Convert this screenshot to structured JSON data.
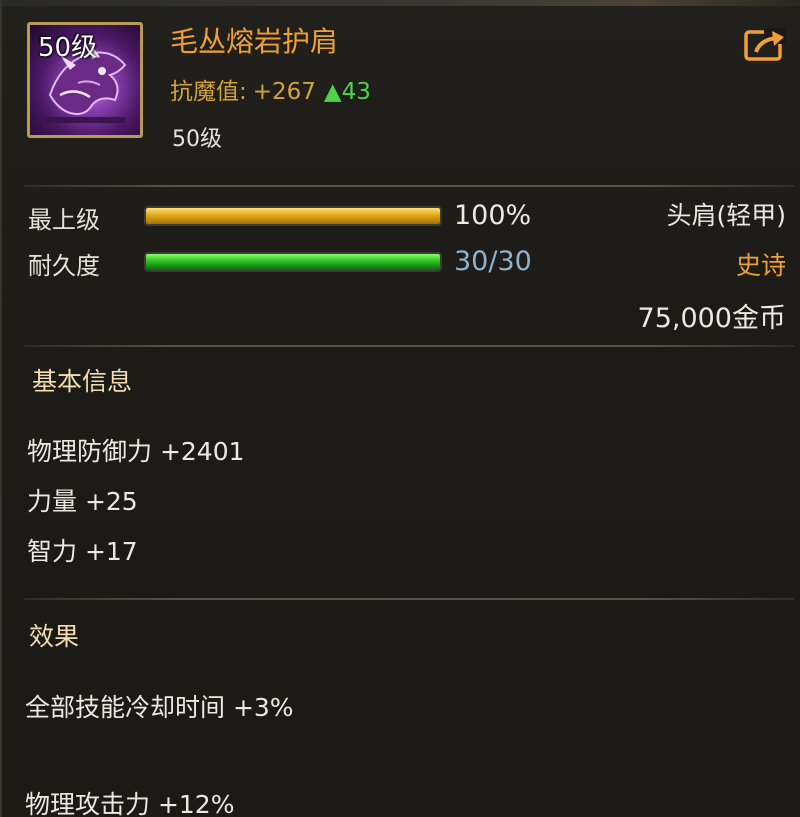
{
  "item": {
    "icon_level": "50级",
    "icon_name": "shoulder-armor-icon",
    "name": "毛丛熔岩护肩",
    "resist_label": "抗魔值:",
    "resist_value": "+267",
    "resist_up": "▲43",
    "level_text": "50级"
  },
  "bars": {
    "grade_label": "最上级",
    "grade_value": "100%",
    "grade_fraction": 1.0,
    "durability_label": "耐久度",
    "durability_value": "30/30",
    "durability_fraction": 1.0
  },
  "info": {
    "slot_type": "头肩(轻甲)",
    "rarity": "史诗",
    "price": "75,000金币"
  },
  "basic": {
    "title": "基本信息",
    "attrs": [
      "物理防御力 +2401",
      "力量 +25",
      "智力 +17"
    ]
  },
  "effects": {
    "title": "效果",
    "lines": [
      "全部技能冷却时间 +3%",
      "物理攻击力 +12%"
    ]
  },
  "colors": {
    "name": "#f0a030",
    "rarity": "#f0a030",
    "gold_bar": "#e0a81c",
    "green_bar": "#2bbd22",
    "stat_up": "#4fd34a"
  }
}
